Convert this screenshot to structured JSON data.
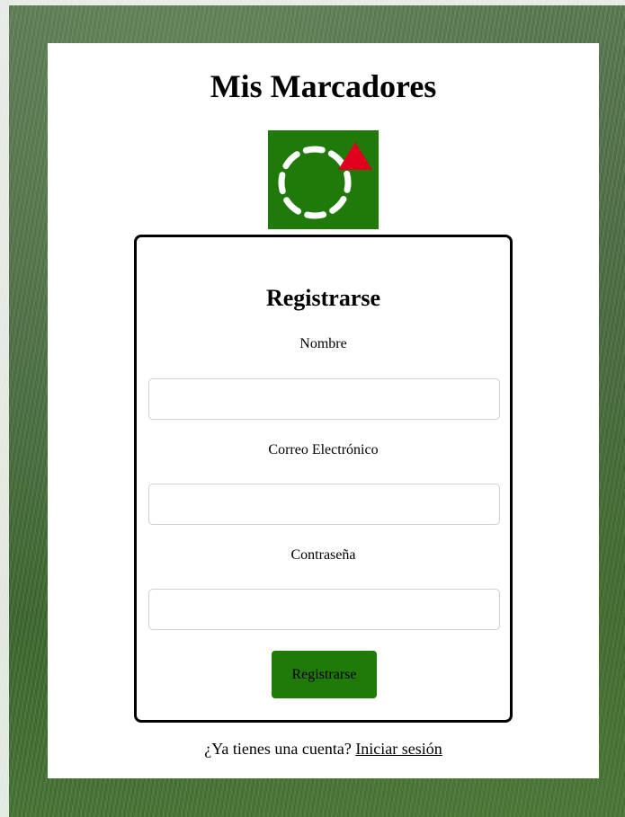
{
  "app": {
    "title": "Mis Marcadores"
  },
  "logo": {
    "icon": "scoreboard-logo-icon",
    "background": "#1f7a0a",
    "accent": "#e0001b"
  },
  "register_form": {
    "heading": "Registrarse",
    "fields": [
      {
        "label": "Nombre",
        "value": "",
        "placeholder": ""
      },
      {
        "label": "Correo Electrónico",
        "value": "",
        "placeholder": ""
      },
      {
        "label": "Contraseña",
        "value": "",
        "placeholder": ""
      }
    ],
    "submit_label": "Registrarse",
    "submit_color": "#1f7a0a"
  },
  "footer": {
    "prompt": "¿Ya tienes una cuenta?",
    "login_link": "Iniciar sesión"
  }
}
